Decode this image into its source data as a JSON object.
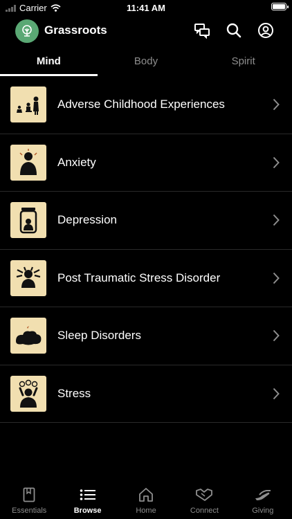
{
  "status_bar": {
    "carrier": "Carrier",
    "time": "11:41 AM"
  },
  "header": {
    "title": "Grassroots",
    "icons": [
      "chat-bubbles-icon",
      "search-icon",
      "profile-icon"
    ]
  },
  "tabs": [
    {
      "label": "Mind",
      "active": true
    },
    {
      "label": "Body",
      "active": false
    },
    {
      "label": "Spirit",
      "active": false
    }
  ],
  "topics": [
    {
      "label": "Adverse Childhood Experiences",
      "icon": "family-silhouette-icon"
    },
    {
      "label": "Anxiety",
      "icon": "anxious-person-icon"
    },
    {
      "label": "Depression",
      "icon": "person-in-jar-icon"
    },
    {
      "label": "Post Traumatic Stress Disorder",
      "icon": "shattered-head-icon"
    },
    {
      "label": "Sleep Disorders",
      "icon": "sleeping-cloud-icon"
    },
    {
      "label": "Stress",
      "icon": "stressed-person-icon"
    }
  ],
  "tabbar": [
    {
      "label": "Essentials",
      "icon": "book-icon",
      "active": false
    },
    {
      "label": "Browse",
      "icon": "list-icon",
      "active": true
    },
    {
      "label": "Home",
      "icon": "home-icon",
      "active": false
    },
    {
      "label": "Connect",
      "icon": "handshake-icon",
      "active": false
    },
    {
      "label": "Giving",
      "icon": "giving-hand-icon",
      "active": false
    }
  ],
  "colors": {
    "background": "#000000",
    "accent": "#5aa874",
    "thumb_bg": "#f1dfb0"
  }
}
